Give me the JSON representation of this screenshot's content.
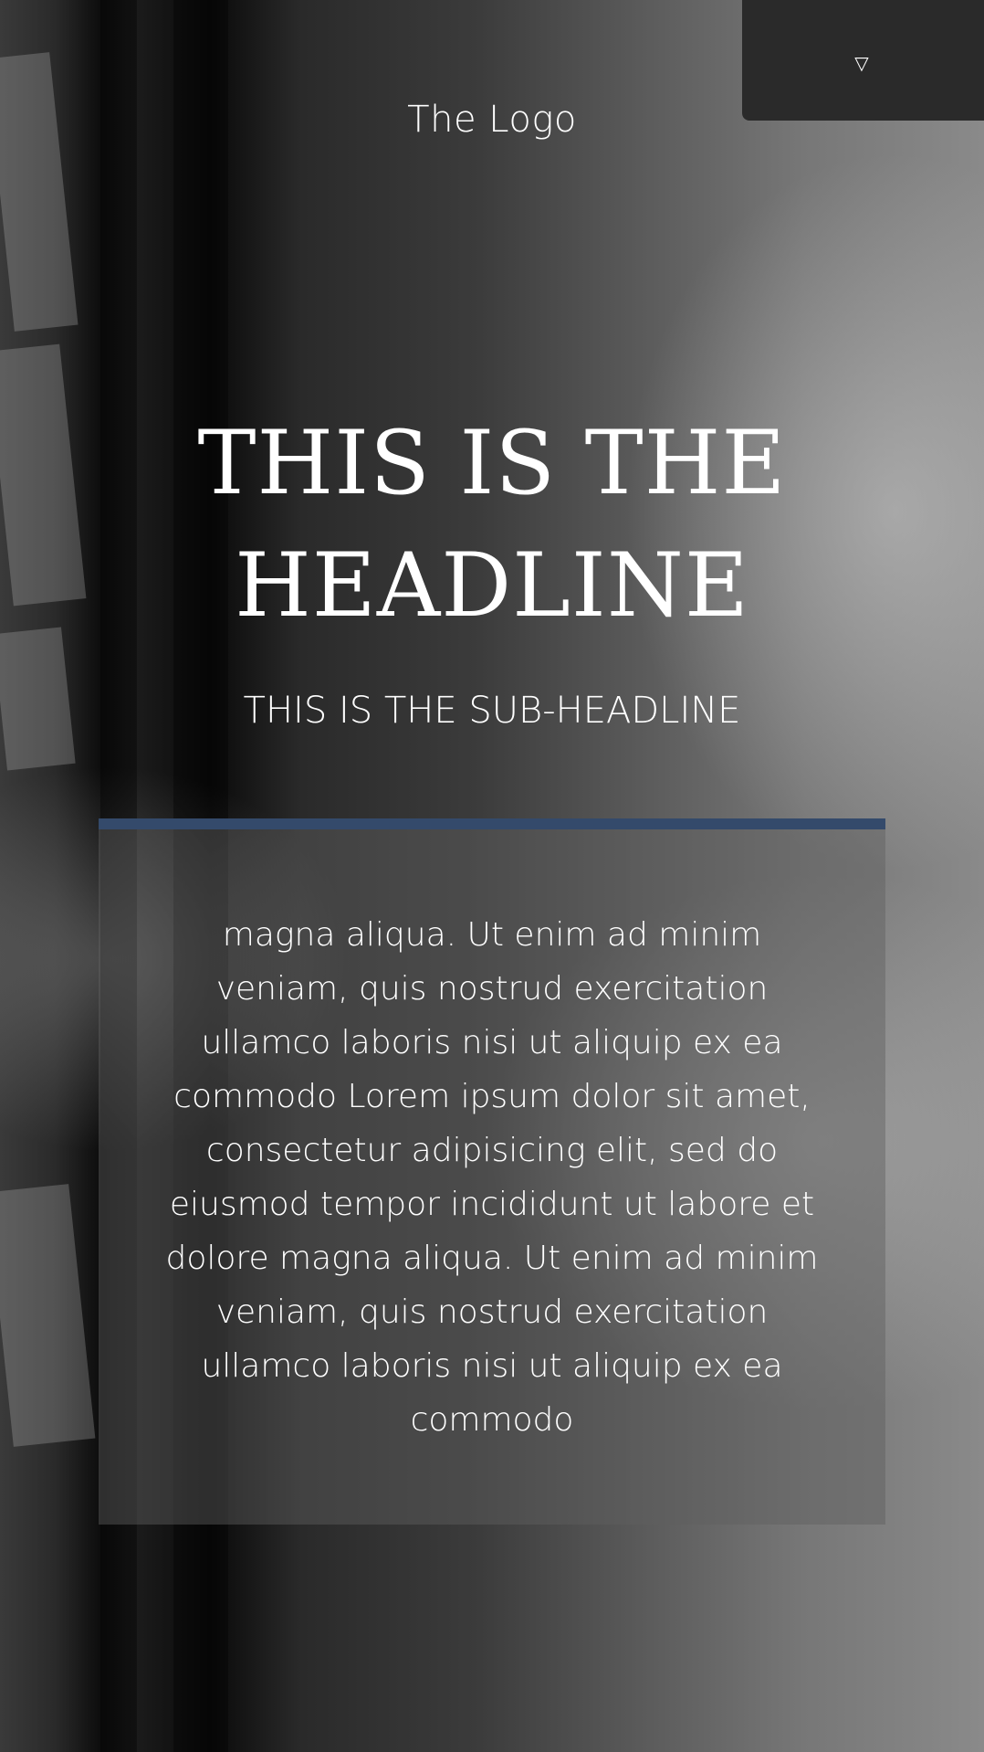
{
  "header": {
    "logo_text": "The Logo",
    "menu_icon": "triangle-down-icon",
    "menu_glyph": "▽"
  },
  "hero": {
    "headline": "THIS IS THE HEADLINE",
    "subheadline": "THIS IS THE SUB-HEADLINE"
  },
  "content": {
    "body_text": "magna aliqua. Ut enim ad minim veniam, quis nostrud exercitation ullamco laboris nisi ut aliquip ex ea commodo Lorem ipsum dolor sit amet, consectetur adipisicing elit, sed do eiusmod tempor incididunt ut labore et dolore magna aliqua. Ut enim ad minim veniam, quis nostrud exercitation ullamco laboris nisi ut aliquip ex ea commodo"
  },
  "colors": {
    "accent_bar": "#344a6b",
    "text": "#ffffff",
    "dropdown_panel": "#2a2a2a"
  }
}
